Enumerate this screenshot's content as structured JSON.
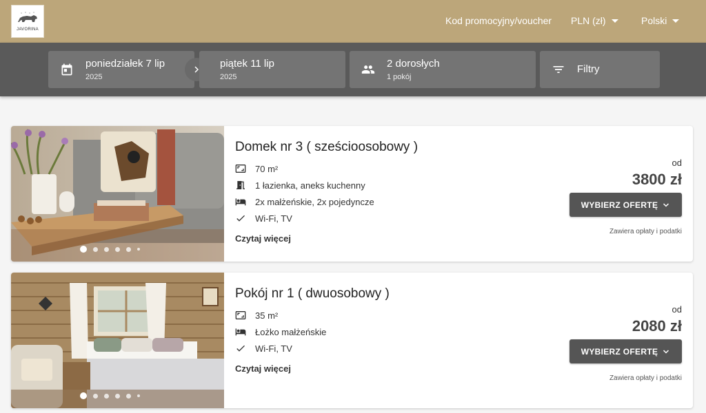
{
  "header": {
    "logo_text": "JAVORINA",
    "promo_link": "Kod promocyjny/voucher",
    "currency": "PLN (zł)",
    "language": "Polski"
  },
  "search": {
    "checkin": {
      "day": "poniedziałek 7 lip",
      "year": "2025"
    },
    "checkout": {
      "day": "piątek 11 lip",
      "year": "2025"
    },
    "guests": {
      "adults": "2 dorosłych",
      "rooms": "1 pokój"
    },
    "filters_label": "Filtry"
  },
  "offers": [
    {
      "title": "Domek nr 3 ( sześcioosobowy )",
      "features": [
        {
          "icon": "area-icon",
          "text": "70 m²"
        },
        {
          "icon": "door-icon",
          "text": "1 łazienka, aneks kuchenny"
        },
        {
          "icon": "bed-icon",
          "text": "2x małżeńskie, 2x pojedyncze"
        },
        {
          "icon": "check-icon",
          "text": "Wi-Fi, TV"
        }
      ],
      "read_more": "Czytaj więcej",
      "from_label": "od",
      "price": "3800 zł",
      "button_label": "WYBIERZ OFERTĘ",
      "fees_note": "Zawiera opłaty i podatki"
    },
    {
      "title": "Pokój nr 1 ( dwuosobowy )",
      "features": [
        {
          "icon": "area-icon",
          "text": "35 m²"
        },
        {
          "icon": "bed-icon",
          "text": "Łożko małżeńskie"
        },
        {
          "icon": "check-icon",
          "text": "Wi-Fi, TV"
        }
      ],
      "read_more": "Czytaj więcej",
      "from_label": "od",
      "price": "2080 zł",
      "button_label": "WYBIERZ OFERTĘ",
      "fees_note": "Zawiera opłaty i podatki"
    }
  ],
  "colors": {
    "header_bg": "#bca67a",
    "searchbar_bg": "#5a5a5a",
    "searchbox_bg": "#747474",
    "button_bg": "#555555"
  }
}
